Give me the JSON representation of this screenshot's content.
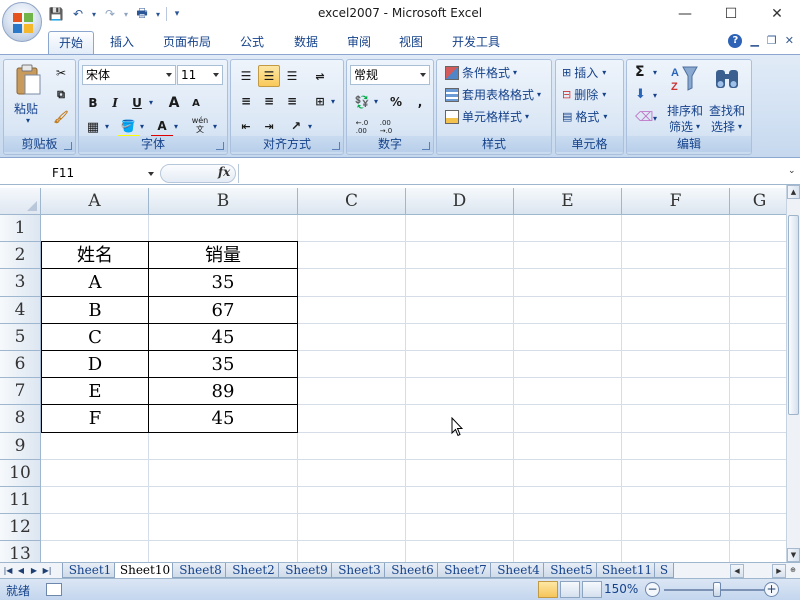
{
  "window": {
    "title": "excel2007 - Microsoft Excel",
    "minimize": "—",
    "maximize": "☐",
    "close": "✕"
  },
  "qat": {
    "save_icon": "💾",
    "undo_icon": "↶",
    "redo_icon": "↷",
    "print_icon": "🖶",
    "more_icon": "▾"
  },
  "ribbon_tabs": [
    "开始",
    "插入",
    "页面布局",
    "公式",
    "数据",
    "审阅",
    "视图",
    "开发工具"
  ],
  "ribbon": {
    "clipboard": {
      "label": "剪贴板",
      "paste": "粘贴"
    },
    "font": {
      "label": "字体",
      "name": "宋体",
      "size": "11",
      "bold": "B",
      "italic": "I",
      "underline": "U",
      "grow": "A",
      "shrink": "A",
      "font_color": "A",
      "phonetic": "wén\n文"
    },
    "alignment": {
      "label": "对齐方式"
    },
    "number": {
      "label": "数字",
      "format": "常规",
      "percent": "%",
      "comma": ",",
      "inc_decimal": "←.0\n.00",
      "dec_decimal": ".00\n→.0"
    },
    "styles": {
      "label": "样式",
      "conditional": "条件格式",
      "table_style": "套用表格格式",
      "cell_style": "单元格样式"
    },
    "cells": {
      "label": "单元格",
      "insert": "插入",
      "delete": "删除",
      "format": "格式"
    },
    "editing": {
      "label": "编辑",
      "sigma": "Σ",
      "sort_filter_1": "排序和",
      "sort_filter_2": "筛选",
      "find_1": "查找和",
      "find_2": "选择"
    }
  },
  "formula_bar": {
    "name_box": "F11",
    "fx": "fx",
    "formula": ""
  },
  "columns": [
    "A",
    "B",
    "C",
    "D",
    "E",
    "F",
    "G"
  ],
  "rows": [
    "1",
    "2",
    "3",
    "4",
    "5",
    "6",
    "7",
    "8",
    "9",
    "10",
    "11",
    "12",
    "13"
  ],
  "table": {
    "header": [
      "姓名",
      "销量"
    ],
    "rows": [
      [
        "A",
        "35"
      ],
      [
        "B",
        "67"
      ],
      [
        "C",
        "45"
      ],
      [
        "D",
        "35"
      ],
      [
        "E",
        "89"
      ],
      [
        "F",
        "45"
      ]
    ]
  },
  "sheet_tabs": [
    "Sheet1",
    "Sheet10",
    "Sheet8",
    "Sheet2",
    "Sheet9",
    "Sheet3",
    "Sheet6",
    "Sheet7",
    "Sheet4",
    "Sheet5",
    "Sheet11",
    "S"
  ],
  "active_sheet": "Sheet10",
  "status": {
    "ready": "就绪",
    "zoom": "150%",
    "zoom_minus": "−",
    "zoom_plus": "+"
  }
}
